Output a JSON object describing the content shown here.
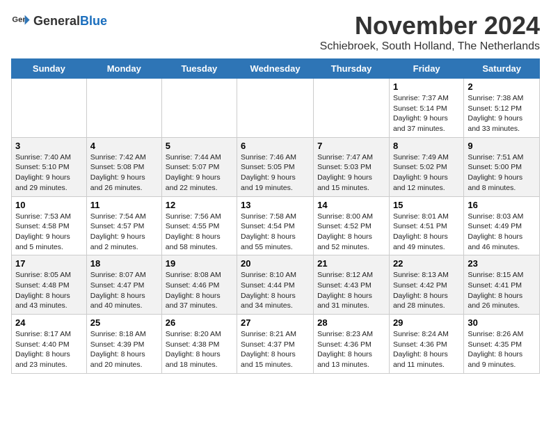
{
  "logo": {
    "text_general": "General",
    "text_blue": "Blue"
  },
  "title": "November 2024",
  "subtitle": "Schiebroek, South Holland, The Netherlands",
  "days_of_week": [
    "Sunday",
    "Monday",
    "Tuesday",
    "Wednesday",
    "Thursday",
    "Friday",
    "Saturday"
  ],
  "weeks": [
    [
      {
        "day": "",
        "info": ""
      },
      {
        "day": "",
        "info": ""
      },
      {
        "day": "",
        "info": ""
      },
      {
        "day": "",
        "info": ""
      },
      {
        "day": "",
        "info": ""
      },
      {
        "day": "1",
        "info": "Sunrise: 7:37 AM\nSunset: 5:14 PM\nDaylight: 9 hours and 37 minutes."
      },
      {
        "day": "2",
        "info": "Sunrise: 7:38 AM\nSunset: 5:12 PM\nDaylight: 9 hours and 33 minutes."
      }
    ],
    [
      {
        "day": "3",
        "info": "Sunrise: 7:40 AM\nSunset: 5:10 PM\nDaylight: 9 hours and 29 minutes."
      },
      {
        "day": "4",
        "info": "Sunrise: 7:42 AM\nSunset: 5:08 PM\nDaylight: 9 hours and 26 minutes."
      },
      {
        "day": "5",
        "info": "Sunrise: 7:44 AM\nSunset: 5:07 PM\nDaylight: 9 hours and 22 minutes."
      },
      {
        "day": "6",
        "info": "Sunrise: 7:46 AM\nSunset: 5:05 PM\nDaylight: 9 hours and 19 minutes."
      },
      {
        "day": "7",
        "info": "Sunrise: 7:47 AM\nSunset: 5:03 PM\nDaylight: 9 hours and 15 minutes."
      },
      {
        "day": "8",
        "info": "Sunrise: 7:49 AM\nSunset: 5:02 PM\nDaylight: 9 hours and 12 minutes."
      },
      {
        "day": "9",
        "info": "Sunrise: 7:51 AM\nSunset: 5:00 PM\nDaylight: 9 hours and 8 minutes."
      }
    ],
    [
      {
        "day": "10",
        "info": "Sunrise: 7:53 AM\nSunset: 4:58 PM\nDaylight: 9 hours and 5 minutes."
      },
      {
        "day": "11",
        "info": "Sunrise: 7:54 AM\nSunset: 4:57 PM\nDaylight: 9 hours and 2 minutes."
      },
      {
        "day": "12",
        "info": "Sunrise: 7:56 AM\nSunset: 4:55 PM\nDaylight: 8 hours and 58 minutes."
      },
      {
        "day": "13",
        "info": "Sunrise: 7:58 AM\nSunset: 4:54 PM\nDaylight: 8 hours and 55 minutes."
      },
      {
        "day": "14",
        "info": "Sunrise: 8:00 AM\nSunset: 4:52 PM\nDaylight: 8 hours and 52 minutes."
      },
      {
        "day": "15",
        "info": "Sunrise: 8:01 AM\nSunset: 4:51 PM\nDaylight: 8 hours and 49 minutes."
      },
      {
        "day": "16",
        "info": "Sunrise: 8:03 AM\nSunset: 4:49 PM\nDaylight: 8 hours and 46 minutes."
      }
    ],
    [
      {
        "day": "17",
        "info": "Sunrise: 8:05 AM\nSunset: 4:48 PM\nDaylight: 8 hours and 43 minutes."
      },
      {
        "day": "18",
        "info": "Sunrise: 8:07 AM\nSunset: 4:47 PM\nDaylight: 8 hours and 40 minutes."
      },
      {
        "day": "19",
        "info": "Sunrise: 8:08 AM\nSunset: 4:46 PM\nDaylight: 8 hours and 37 minutes."
      },
      {
        "day": "20",
        "info": "Sunrise: 8:10 AM\nSunset: 4:44 PM\nDaylight: 8 hours and 34 minutes."
      },
      {
        "day": "21",
        "info": "Sunrise: 8:12 AM\nSunset: 4:43 PM\nDaylight: 8 hours and 31 minutes."
      },
      {
        "day": "22",
        "info": "Sunrise: 8:13 AM\nSunset: 4:42 PM\nDaylight: 8 hours and 28 minutes."
      },
      {
        "day": "23",
        "info": "Sunrise: 8:15 AM\nSunset: 4:41 PM\nDaylight: 8 hours and 26 minutes."
      }
    ],
    [
      {
        "day": "24",
        "info": "Sunrise: 8:17 AM\nSunset: 4:40 PM\nDaylight: 8 hours and 23 minutes."
      },
      {
        "day": "25",
        "info": "Sunrise: 8:18 AM\nSunset: 4:39 PM\nDaylight: 8 hours and 20 minutes."
      },
      {
        "day": "26",
        "info": "Sunrise: 8:20 AM\nSunset: 4:38 PM\nDaylight: 8 hours and 18 minutes."
      },
      {
        "day": "27",
        "info": "Sunrise: 8:21 AM\nSunset: 4:37 PM\nDaylight: 8 hours and 15 minutes."
      },
      {
        "day": "28",
        "info": "Sunrise: 8:23 AM\nSunset: 4:36 PM\nDaylight: 8 hours and 13 minutes."
      },
      {
        "day": "29",
        "info": "Sunrise: 8:24 AM\nSunset: 4:36 PM\nDaylight: 8 hours and 11 minutes."
      },
      {
        "day": "30",
        "info": "Sunrise: 8:26 AM\nSunset: 4:35 PM\nDaylight: 8 hours and 9 minutes."
      }
    ]
  ]
}
